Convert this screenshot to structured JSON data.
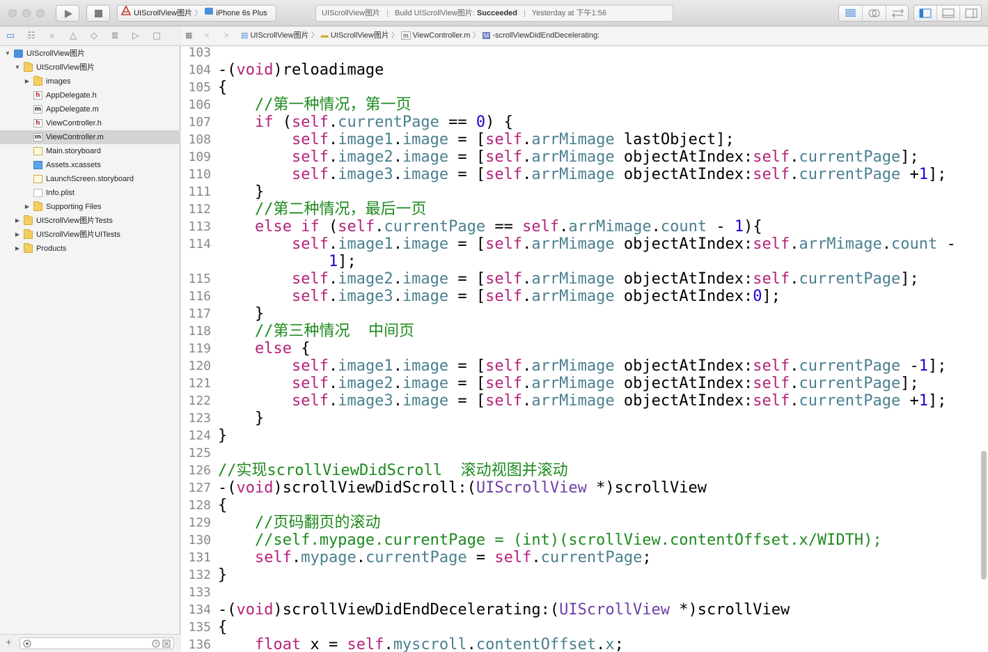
{
  "toolbar": {
    "scheme_project": "UIScrollView图片",
    "scheme_device": "iPhone 6s Plus",
    "status_project": "UIScrollView图片",
    "status_build_prefix": "Build UIScrollView图片: ",
    "status_build_result": "Succeeded",
    "status_time": "Yesterday at 下午1:56"
  },
  "navigator": {
    "tree": [
      {
        "label": "UIScrollView图片",
        "icon": "project",
        "indent": 0,
        "disclosure": "open",
        "selected": false
      },
      {
        "label": "UIScrollView图片",
        "icon": "folder",
        "indent": 1,
        "disclosure": "open",
        "selected": false
      },
      {
        "label": "images",
        "icon": "folder",
        "indent": 2,
        "disclosure": "closed",
        "selected": false
      },
      {
        "label": "AppDelegate.h",
        "icon": "h-file",
        "indent": 2,
        "disclosure": "none",
        "selected": false
      },
      {
        "label": "AppDelegate.m",
        "icon": "m-file",
        "indent": 2,
        "disclosure": "none",
        "selected": false
      },
      {
        "label": "ViewController.h",
        "icon": "h-file",
        "indent": 2,
        "disclosure": "none",
        "selected": false
      },
      {
        "label": "ViewController.m",
        "icon": "m-file",
        "indent": 2,
        "disclosure": "none",
        "selected": true
      },
      {
        "label": "Main.storyboard",
        "icon": "storyboard",
        "indent": 2,
        "disclosure": "none",
        "selected": false
      },
      {
        "label": "Assets.xcassets",
        "icon": "xcassets",
        "indent": 2,
        "disclosure": "none",
        "selected": false
      },
      {
        "label": "LaunchScreen.storyboard",
        "icon": "storyboard",
        "indent": 2,
        "disclosure": "none",
        "selected": false
      },
      {
        "label": "Info.plist",
        "icon": "plist",
        "indent": 2,
        "disclosure": "none",
        "selected": false
      },
      {
        "label": "Supporting Files",
        "icon": "folder",
        "indent": 2,
        "disclosure": "closed",
        "selected": false
      },
      {
        "label": "UIScrollView图片Tests",
        "icon": "folder",
        "indent": 1,
        "disclosure": "closed",
        "selected": false
      },
      {
        "label": "UIScrollView图片UITests",
        "icon": "folder",
        "indent": 1,
        "disclosure": "closed",
        "selected": false
      },
      {
        "label": "Products",
        "icon": "folder",
        "indent": 1,
        "disclosure": "closed",
        "selected": false
      }
    ]
  },
  "jumpbar": {
    "crumb1": "UIScrollView图片",
    "crumb2": "UIScrollView图片",
    "crumb3": "ViewController.m",
    "crumb4": "-scrollViewDidEndDecelerating:"
  },
  "editor": {
    "line_numbers": [
      "103",
      "104",
      "105",
      "106",
      "107",
      "108",
      "109",
      "110",
      "111",
      "112",
      "113",
      "114",
      "",
      "115",
      "116",
      "117",
      "118",
      "119",
      "120",
      "121",
      "122",
      "123",
      "124",
      "125",
      "126",
      "127",
      "128",
      "129",
      "130",
      "131",
      "132",
      "133",
      "134",
      "135",
      "136"
    ],
    "lines": [
      [],
      [
        [
          "-(",
          "p"
        ],
        [
          "void",
          "k"
        ],
        [
          ")reloadimage",
          "p"
        ]
      ],
      [
        [
          "{",
          "p"
        ]
      ],
      [
        [
          "    //第一种情况，第一页",
          "c"
        ]
      ],
      [
        [
          "    ",
          "p"
        ],
        [
          "if",
          "k"
        ],
        [
          " (",
          "p"
        ],
        [
          "self",
          "k"
        ],
        [
          ".",
          "p"
        ],
        [
          "currentPage",
          "v"
        ],
        [
          " == ",
          "p"
        ],
        [
          "0",
          "n"
        ],
        [
          ") {",
          "p"
        ]
      ],
      [
        [
          "        ",
          "p"
        ],
        [
          "self",
          "k"
        ],
        [
          ".",
          "p"
        ],
        [
          "image1",
          "v"
        ],
        [
          ".",
          "p"
        ],
        [
          "image",
          "v"
        ],
        [
          " = [",
          "p"
        ],
        [
          "self",
          "k"
        ],
        [
          ".",
          "p"
        ],
        [
          "arrMimage",
          "v"
        ],
        [
          " lastObject];",
          "p"
        ]
      ],
      [
        [
          "        ",
          "p"
        ],
        [
          "self",
          "k"
        ],
        [
          ".",
          "p"
        ],
        [
          "image2",
          "v"
        ],
        [
          ".",
          "p"
        ],
        [
          "image",
          "v"
        ],
        [
          " = [",
          "p"
        ],
        [
          "self",
          "k"
        ],
        [
          ".",
          "p"
        ],
        [
          "arrMimage",
          "v"
        ],
        [
          " objectAtIndex:",
          "p"
        ],
        [
          "self",
          "k"
        ],
        [
          ".",
          "p"
        ],
        [
          "currentPage",
          "v"
        ],
        [
          "];",
          "p"
        ]
      ],
      [
        [
          "        ",
          "p"
        ],
        [
          "self",
          "k"
        ],
        [
          ".",
          "p"
        ],
        [
          "image3",
          "v"
        ],
        [
          ".",
          "p"
        ],
        [
          "image",
          "v"
        ],
        [
          " = [",
          "p"
        ],
        [
          "self",
          "k"
        ],
        [
          ".",
          "p"
        ],
        [
          "arrMimage",
          "v"
        ],
        [
          " objectAtIndex:",
          "p"
        ],
        [
          "self",
          "k"
        ],
        [
          ".",
          "p"
        ],
        [
          "currentPage",
          "v"
        ],
        [
          " +",
          "p"
        ],
        [
          "1",
          "n"
        ],
        [
          "];",
          "p"
        ]
      ],
      [
        [
          "    }",
          "p"
        ]
      ],
      [
        [
          "    //第二种情况，最后一页",
          "c"
        ]
      ],
      [
        [
          "    ",
          "p"
        ],
        [
          "else",
          "k"
        ],
        [
          " ",
          "p"
        ],
        [
          "if",
          "k"
        ],
        [
          " (",
          "p"
        ],
        [
          "self",
          "k"
        ],
        [
          ".",
          "p"
        ],
        [
          "currentPage",
          "v"
        ],
        [
          " == ",
          "p"
        ],
        [
          "self",
          "k"
        ],
        [
          ".",
          "p"
        ],
        [
          "arrMimage",
          "v"
        ],
        [
          ".",
          "p"
        ],
        [
          "count",
          "v"
        ],
        [
          " - ",
          "p"
        ],
        [
          "1",
          "n"
        ],
        [
          "){",
          "p"
        ]
      ],
      [
        [
          "        ",
          "p"
        ],
        [
          "self",
          "k"
        ],
        [
          ".",
          "p"
        ],
        [
          "image1",
          "v"
        ],
        [
          ".",
          "p"
        ],
        [
          "image",
          "v"
        ],
        [
          " = [",
          "p"
        ],
        [
          "self",
          "k"
        ],
        [
          ".",
          "p"
        ],
        [
          "arrMimage",
          "v"
        ],
        [
          " objectAtIndex:",
          "p"
        ],
        [
          "self",
          "k"
        ],
        [
          ".",
          "p"
        ],
        [
          "arrMimage",
          "v"
        ],
        [
          ".",
          "p"
        ],
        [
          "count",
          "v"
        ],
        [
          " -",
          "p"
        ]
      ],
      [
        [
          "            ",
          "p"
        ],
        [
          "1",
          "n"
        ],
        [
          "];",
          "p"
        ]
      ],
      [
        [
          "        ",
          "p"
        ],
        [
          "self",
          "k"
        ],
        [
          ".",
          "p"
        ],
        [
          "image2",
          "v"
        ],
        [
          ".",
          "p"
        ],
        [
          "image",
          "v"
        ],
        [
          " = [",
          "p"
        ],
        [
          "self",
          "k"
        ],
        [
          ".",
          "p"
        ],
        [
          "arrMimage",
          "v"
        ],
        [
          " objectAtIndex:",
          "p"
        ],
        [
          "self",
          "k"
        ],
        [
          ".",
          "p"
        ],
        [
          "currentPage",
          "v"
        ],
        [
          "];",
          "p"
        ]
      ],
      [
        [
          "        ",
          "p"
        ],
        [
          "self",
          "k"
        ],
        [
          ".",
          "p"
        ],
        [
          "image3",
          "v"
        ],
        [
          ".",
          "p"
        ],
        [
          "image",
          "v"
        ],
        [
          " = [",
          "p"
        ],
        [
          "self",
          "k"
        ],
        [
          ".",
          "p"
        ],
        [
          "arrMimage",
          "v"
        ],
        [
          " objectAtIndex:",
          "p"
        ],
        [
          "0",
          "n"
        ],
        [
          "];",
          "p"
        ]
      ],
      [
        [
          "    }",
          "p"
        ]
      ],
      [
        [
          "    //第三种情况  中间页",
          "c"
        ]
      ],
      [
        [
          "    ",
          "p"
        ],
        [
          "else",
          "k"
        ],
        [
          " {",
          "p"
        ]
      ],
      [
        [
          "        ",
          "p"
        ],
        [
          "self",
          "k"
        ],
        [
          ".",
          "p"
        ],
        [
          "image1",
          "v"
        ],
        [
          ".",
          "p"
        ],
        [
          "image",
          "v"
        ],
        [
          " = [",
          "p"
        ],
        [
          "self",
          "k"
        ],
        [
          ".",
          "p"
        ],
        [
          "arrMimage",
          "v"
        ],
        [
          " objectAtIndex:",
          "p"
        ],
        [
          "self",
          "k"
        ],
        [
          ".",
          "p"
        ],
        [
          "currentPage",
          "v"
        ],
        [
          " -",
          "p"
        ],
        [
          "1",
          "n"
        ],
        [
          "];",
          "p"
        ]
      ],
      [
        [
          "        ",
          "p"
        ],
        [
          "self",
          "k"
        ],
        [
          ".",
          "p"
        ],
        [
          "image2",
          "v"
        ],
        [
          ".",
          "p"
        ],
        [
          "image",
          "v"
        ],
        [
          " = [",
          "p"
        ],
        [
          "self",
          "k"
        ],
        [
          ".",
          "p"
        ],
        [
          "arrMimage",
          "v"
        ],
        [
          " objectAtIndex:",
          "p"
        ],
        [
          "self",
          "k"
        ],
        [
          ".",
          "p"
        ],
        [
          "currentPage",
          "v"
        ],
        [
          "];",
          "p"
        ]
      ],
      [
        [
          "        ",
          "p"
        ],
        [
          "self",
          "k"
        ],
        [
          ".",
          "p"
        ],
        [
          "image3",
          "v"
        ],
        [
          ".",
          "p"
        ],
        [
          "image",
          "v"
        ],
        [
          " = [",
          "p"
        ],
        [
          "self",
          "k"
        ],
        [
          ".",
          "p"
        ],
        [
          "arrMimage",
          "v"
        ],
        [
          " objectAtIndex:",
          "p"
        ],
        [
          "self",
          "k"
        ],
        [
          ".",
          "p"
        ],
        [
          "currentPage",
          "v"
        ],
        [
          " +",
          "p"
        ],
        [
          "1",
          "n"
        ],
        [
          "];",
          "p"
        ]
      ],
      [
        [
          "    }",
          "p"
        ]
      ],
      [
        [
          "}",
          "p"
        ]
      ],
      [],
      [
        [
          "//实现scrollViewDidScroll  滚动视图并滚动",
          "c"
        ]
      ],
      [
        [
          "-(",
          "p"
        ],
        [
          "void",
          "k"
        ],
        [
          ")scrollViewDidScroll:(",
          "p"
        ],
        [
          "UIScrollView",
          "t"
        ],
        [
          " *)scrollView",
          "p"
        ]
      ],
      [
        [
          "{",
          "p"
        ]
      ],
      [
        [
          "    //页码翻页的滚动",
          "c"
        ]
      ],
      [
        [
          "    //self.mypage.currentPage = (int)(scrollView.contentOffset.x/WIDTH);",
          "c"
        ]
      ],
      [
        [
          "    ",
          "p"
        ],
        [
          "self",
          "k"
        ],
        [
          ".",
          "p"
        ],
        [
          "mypage",
          "v"
        ],
        [
          ".",
          "p"
        ],
        [
          "currentPage",
          "v"
        ],
        [
          " = ",
          "p"
        ],
        [
          "self",
          "k"
        ],
        [
          ".",
          "p"
        ],
        [
          "currentPage",
          "v"
        ],
        [
          ";",
          "p"
        ]
      ],
      [
        [
          "}",
          "p"
        ]
      ],
      [],
      [
        [
          "-(",
          "p"
        ],
        [
          "void",
          "k"
        ],
        [
          ")scrollViewDidEndDecelerating:(",
          "p"
        ],
        [
          "UIScrollView",
          "t"
        ],
        [
          " *)scrollView",
          "p"
        ]
      ],
      [
        [
          "{",
          "p"
        ]
      ],
      [
        [
          "    ",
          "p"
        ],
        [
          "float",
          "k"
        ],
        [
          " x = ",
          "p"
        ],
        [
          "self",
          "k"
        ],
        [
          ".",
          "p"
        ],
        [
          "myscroll",
          "v"
        ],
        [
          ".",
          "p"
        ],
        [
          "contentOffset",
          "v"
        ],
        [
          ".",
          "p"
        ],
        [
          "x",
          "v"
        ],
        [
          ";",
          "p"
        ]
      ]
    ]
  },
  "colors": {
    "keyword": "#b4237a",
    "property": "#4a7f8f",
    "class": "#6e3fa6",
    "comment": "#1e8a1e",
    "number": "#1c00cf",
    "selection": "#d4d4d4",
    "accent": "#2f7bd6"
  }
}
